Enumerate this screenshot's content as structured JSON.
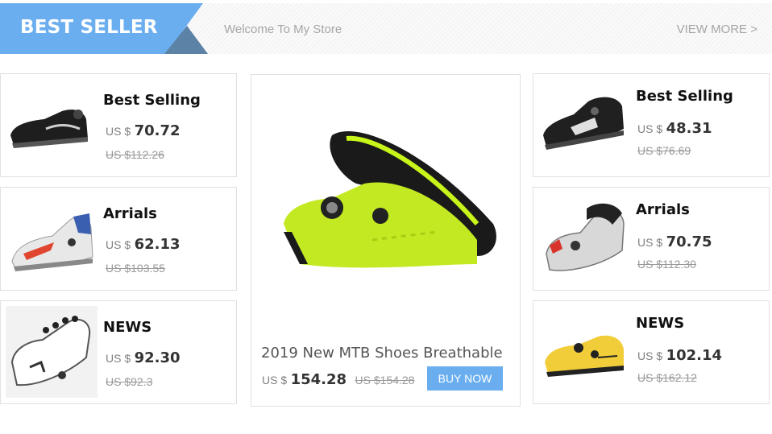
{
  "header": {
    "badge_label": "BEST SELLER",
    "welcome": "Welcome To My Store",
    "view_more": "VIEW MORE >"
  },
  "colors": {
    "accent_blue": "#6aaef0",
    "badge_dark": "#5c82a6"
  },
  "currency_prefix": "US $",
  "left_cards": [
    {
      "title": "Best Selling",
      "price": "70.72",
      "old_price": "US $112.26",
      "shoe": "black-cycling-shoe-icon"
    },
    {
      "title": "Arrials",
      "price": "62.13",
      "old_price": "US $103.55",
      "shoe": "white-red-golf-shoe-icon"
    },
    {
      "title": "NEWS",
      "price": "92.30",
      "old_price": "US $92.3",
      "shoe": "white-golf-shoe-icon"
    }
  ],
  "featured": {
    "title": "2019 New MTB Shoes Breathable",
    "price": "154.28",
    "old_price": "US $154.28",
    "buy_label": "BUY NOW",
    "shoe": "neon-green-cycling-shoe-icon"
  },
  "right_cards": [
    {
      "title": "Best Selling",
      "price": "48.31",
      "old_price": "US $76.69",
      "shoe": "black-mtb-shoe-icon"
    },
    {
      "title": "Arrials",
      "price": "70.75",
      "old_price": "US $112.30",
      "shoe": "silver-red-mtb-shoe-icon"
    },
    {
      "title": "NEWS",
      "price": "102.14",
      "old_price": "US $162.12",
      "shoe": "yellow-cycling-shoe-icon"
    }
  ]
}
